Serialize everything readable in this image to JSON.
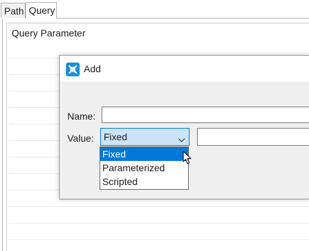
{
  "tabs": [
    {
      "label": "Path"
    },
    {
      "label": "Query"
    }
  ],
  "panel": {
    "section_title": "Query Parameter"
  },
  "dialog": {
    "title": "Add",
    "name_label": "Name:",
    "name_value": "",
    "value_label": "Value:",
    "value_selected": "Fixed",
    "value_text": "",
    "options": [
      "Fixed",
      "Parameterized",
      "Scripted"
    ],
    "highlighted_option": "Fixed"
  },
  "colors": {
    "accent": "#0078d7",
    "select_bg": "#cce4f7",
    "icon_blue": "#1c8fd6"
  },
  "icons": {
    "app": "app-logo-icon",
    "dropdown": "chevron-down-icon",
    "pointer": "mouse-cursor-icon"
  }
}
